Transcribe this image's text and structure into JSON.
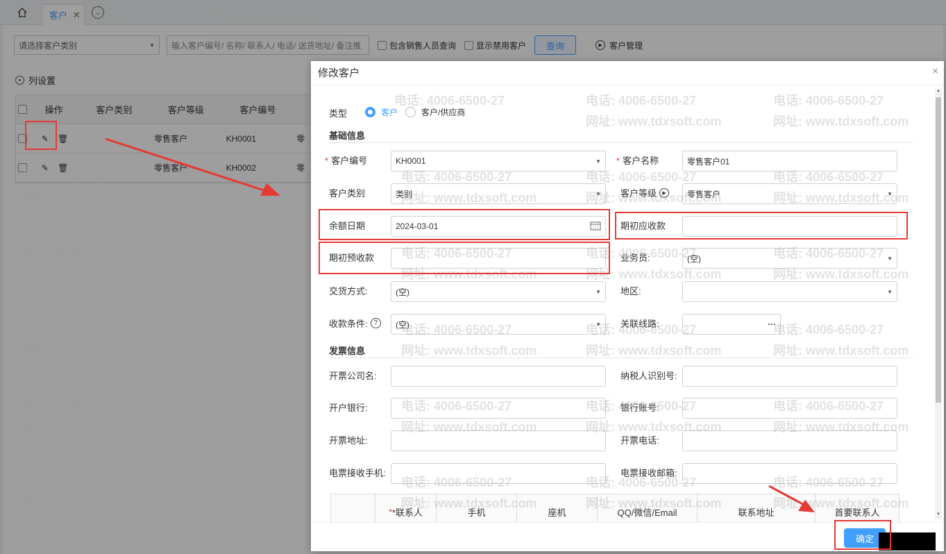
{
  "tabs": {
    "active_label": "客户"
  },
  "toolbar": {
    "category_placeholder": "请选择客户类别",
    "search_placeholder": "输入客户编号/ 名称/ 联系人/ 电话/ 送货地址/ 备注推",
    "include_sales_label": "包含销售人员查询",
    "show_disabled_label": "显示禁用客户",
    "query_button": "查询",
    "manage_label": "客户管理"
  },
  "column_settings_label": "列设置",
  "grid": {
    "headers": [
      "操作",
      "客户类别",
      "客户等级",
      "客户编号",
      "零"
    ],
    "rows": [
      {
        "level": "零售客户",
        "code": "KH0001",
        "trunc": "零"
      },
      {
        "level": "零售客户",
        "code": "KH0002",
        "trunc": "零"
      }
    ]
  },
  "watermark": {
    "phone": "电话: 4006-6500-27",
    "site": "网址: www.tdxsoft.com"
  },
  "dialog": {
    "title": "修改客户",
    "type_label": "类型",
    "type_options": [
      "客户",
      "客户/供应商"
    ],
    "section_basic": "基础信息",
    "section_invoice": "发票信息",
    "fields": {
      "customer_code_label": "客户编号",
      "customer_code_value": "KH0001",
      "customer_name_label": "客户名称",
      "customer_name_value": "零售客户01",
      "customer_category_label": "客户类别",
      "customer_category_value": "类别",
      "customer_level_label": "客户等级",
      "customer_level_value": "零售客户",
      "balance_date_label": "余额日期",
      "balance_date_value": "2024-03-01",
      "opening_receivable_label": "期初应收款",
      "opening_prepaid_label": "期初预收款",
      "salesman_label": "业务员:",
      "salesman_value": "(空)",
      "delivery_label": "交货方式:",
      "delivery_value": "(空)",
      "region_label": "地区:",
      "payment_terms_label": "收款条件:",
      "payment_terms_value": "(空)",
      "route_label": "关联线路:",
      "route_button": "···",
      "invoice_company_label": "开票公司名:",
      "taxpayer_id_label": "纳税人识别号:",
      "bank_label": "开户银行:",
      "bank_account_label": "银行账号:",
      "invoice_address_label": "开票地址:",
      "invoice_phone_label": "开票电话:",
      "e_invoice_phone_label": "电票接收手机:",
      "e_invoice_email_label": "电票接收邮箱:"
    },
    "contact_columns": [
      "*联系人",
      "手机",
      "座机",
      "QQ/微信/Email",
      "联系地址",
      "首要联系人"
    ],
    "ok_button": "确定"
  },
  "colors": {
    "accent": "#409eff",
    "highlight": "#e53935",
    "required": "#e53935"
  }
}
